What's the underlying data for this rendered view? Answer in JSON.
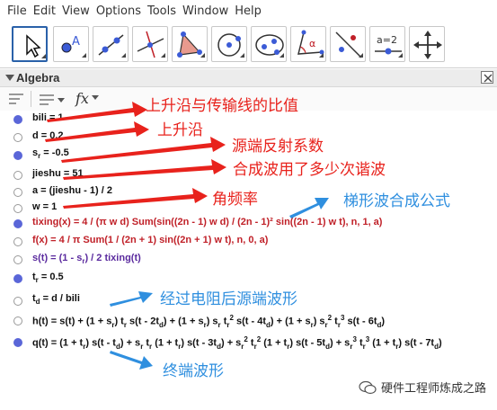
{
  "menu": [
    "File",
    "Edit",
    "View",
    "Options",
    "Tools",
    "Window",
    "Help"
  ],
  "toolbar": {
    "tools": [
      {
        "name": "move",
        "icon": "arrow-pointer-icon"
      },
      {
        "name": "point",
        "icon": "point-a-icon",
        "label": "A"
      },
      {
        "name": "line",
        "icon": "line-through-points-icon"
      },
      {
        "name": "perpendicular",
        "icon": "perpendicular-line-icon"
      },
      {
        "name": "polygon",
        "icon": "polygon-icon"
      },
      {
        "name": "circle",
        "icon": "circle-center-point-icon"
      },
      {
        "name": "ellipse",
        "icon": "ellipse-icon"
      },
      {
        "name": "angle",
        "icon": "angle-icon",
        "label": "α"
      },
      {
        "name": "reflect",
        "icon": "reflect-line-icon"
      },
      {
        "name": "slider",
        "icon": "slider-icon",
        "label": "a=2"
      },
      {
        "name": "move-view",
        "icon": "move-graphics-view-icon"
      }
    ]
  },
  "algebra": {
    "title": "Algebra",
    "fx_label": "fx",
    "rows": [
      {
        "text_html": "bili = 1",
        "color": "black",
        "dot": "filled"
      },
      {
        "text_html": "d = 0.2",
        "color": "black",
        "dot": "empty"
      },
      {
        "text_html": "s<sub>r</sub> = -0.5",
        "color": "black",
        "dot": "filled"
      },
      {
        "text_html": "jieshu = 51",
        "color": "black",
        "dot": "empty"
      },
      {
        "text_html": "a = (jieshu - 1) / 2",
        "color": "black",
        "dot": "empty"
      },
      {
        "text_html": "w = 1",
        "color": "black",
        "dot": "empty"
      },
      {
        "text_html": "tixing(x) = 4 / (π w d) Sum(sin((2n - 1) w d) / (2n - 1)² sin((2n - 1) w t), n, 1, a)",
        "color": "red",
        "dot": "filled"
      },
      {
        "text_html": "f(x) = 4 / π Sum(1 / (2n + 1) sin((2n + 1) w t), n, 0, a)",
        "color": "red",
        "dot": "empty"
      },
      {
        "text_html": "s(t) = (1 - s<sub>r</sub>) / 2 tixing(t)",
        "color": "purple",
        "dot": "empty"
      },
      {
        "text_html": "t<sub>r</sub> = 0.5",
        "color": "black",
        "dot": "filled"
      },
      {
        "text_html": "t<sub>d</sub> = d / bili",
        "color": "black",
        "dot": "empty"
      },
      {
        "text_html": "h(t) = s(t) + (1 + s<sub>r</sub>) t<sub>r</sub> s(t - 2t<sub>d</sub>) + (1 + s<sub>r</sub>) s<sub>r</sub> t<sub>r</sub><sup>2</sup> s(t - 4t<sub>d</sub>) + (1 + s<sub>r</sub>) s<sub>r</sub><sup>2</sup> t<sub>r</sub><sup>3</sup> s(t - 6t<sub>d</sub>)",
        "color": "black",
        "dot": "empty"
      },
      {
        "text_html": "q(t) = (1 + t<sub>r</sub>) s(t - t<sub>d</sub>) + s<sub>r</sub> t<sub>r</sub> (1 + t<sub>r</sub>) s(t - 3t<sub>d</sub>) + s<sub>r</sub><sup>2</sup> t<sub>r</sub><sup>2</sup> (1 + t<sub>r</sub>) s(t - 5t<sub>d</sub>) + s<sub>r</sub><sup>3</sup> t<sub>r</sub><sup>3</sup> (1 + t<sub>r</sub>) s(t - 7t<sub>d</sub>)",
        "color": "black",
        "dot": "filled"
      }
    ]
  },
  "annotations": {
    "rise_to_line_ratio": "上升沿与传输线的比值",
    "rise_edge": "上升沿",
    "source_reflection": "源端反射系数",
    "harmonics_count": "合成波用了多少次谐波",
    "angular_frequency": "角频率",
    "trapezoid_formula": "梯形波合成公式",
    "source_wave_after_resistor": "经过电阻后源端波形",
    "terminal_wave": "终端波形"
  },
  "watermark": "硬件工程师炼成之路",
  "colors": {
    "selection_border": "#2a61a9",
    "dot_filled": "#5a66d8",
    "red_expr": "#c02028",
    "purple_expr": "#5a2a9e",
    "annotation_red": "#e8221c",
    "annotation_blue": "#2f8fdf"
  }
}
